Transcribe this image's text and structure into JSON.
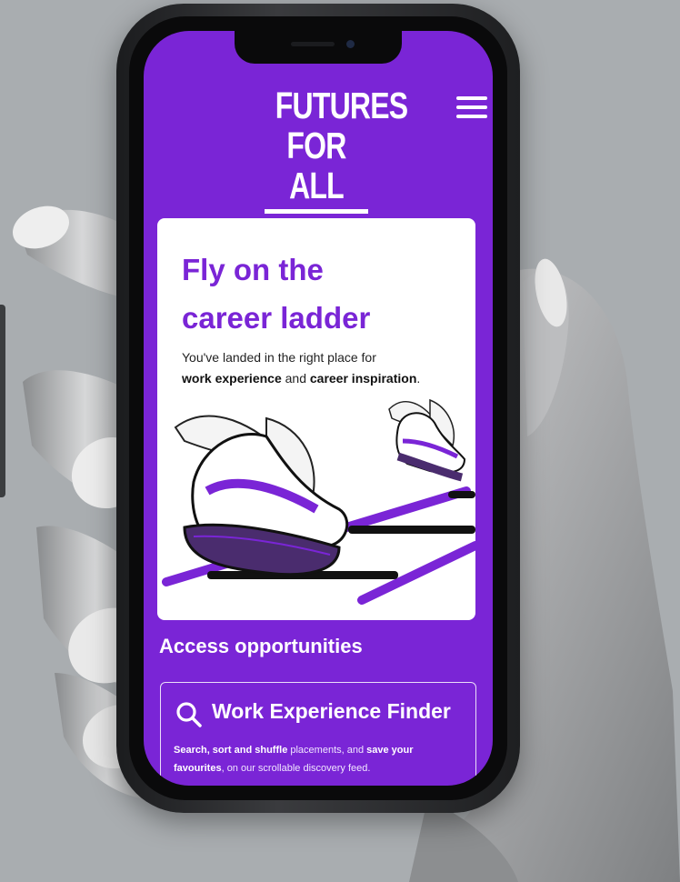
{
  "app": {
    "brand_line1": "FUTURES",
    "brand_line2": "FOR ALL",
    "menu_icon": "hamburger-icon"
  },
  "hero": {
    "title_line1": "Fly on the",
    "title_line2": "career ladder",
    "intro_prefix": "You've landed in the right place for",
    "intro_bold1": "work experience",
    "intro_mid": "and",
    "intro_bold2": "career inspiration",
    "intro_end": "."
  },
  "opportunities": {
    "section_title": "Access opportunities",
    "finder": {
      "icon": "search-icon",
      "title": "Work Experience Finder",
      "desc_bold1": "Search, sort and shuffle",
      "desc_mid1": "placements, and",
      "desc_bold2": "save your favourites",
      "desc_end": ", on our scrollable discovery feed."
    }
  },
  "colors": {
    "brand_purple": "#7a25d6",
    "card_white": "#ffffff",
    "phone_frame": "#1b1c1e"
  }
}
